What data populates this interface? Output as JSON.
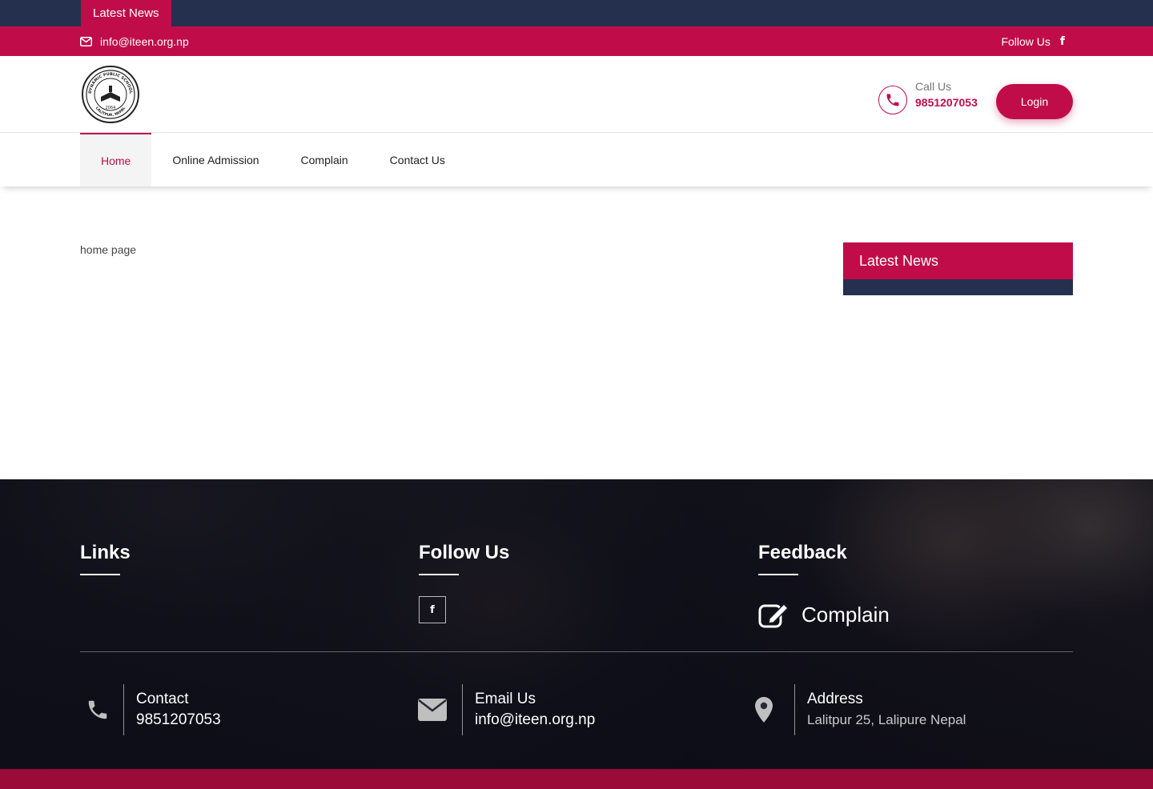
{
  "ticker": {
    "label": "Latest News"
  },
  "topbar": {
    "email": "info@iteen.org.np",
    "follow_label": "Follow Us",
    "facebook_glyph": "f"
  },
  "header": {
    "logo": {
      "text_top": "DYNAMIC PUBLIC SCHOOL",
      "year": "2064",
      "text_bottom": "LALITPUR, NEPAL"
    },
    "call_label": "Call Us",
    "call_number": "9851207053",
    "login_label": "Login"
  },
  "nav": {
    "items": [
      {
        "label": "Home"
      },
      {
        "label": "Online Admission"
      },
      {
        "label": "Complain"
      },
      {
        "label": "Contact Us"
      }
    ]
  },
  "main": {
    "body_text": "home page",
    "news_title": "Latest News"
  },
  "footer": {
    "links_title": "Links",
    "follow_title": "Follow Us",
    "facebook_glyph": "f",
    "feedback_title": "Feedback",
    "complain_label": "Complain",
    "contact": {
      "label": "Contact",
      "value": "9851207053"
    },
    "email": {
      "label": "Email Us",
      "value": "info@iteen.org.np"
    },
    "address": {
      "label": "Address",
      "value": "Lalitpur 25, Lalipure Nepal"
    }
  },
  "colors": {
    "brand": "#c00d4a",
    "navy": "#24304d",
    "bottom_bar": "#9b0b3a"
  }
}
